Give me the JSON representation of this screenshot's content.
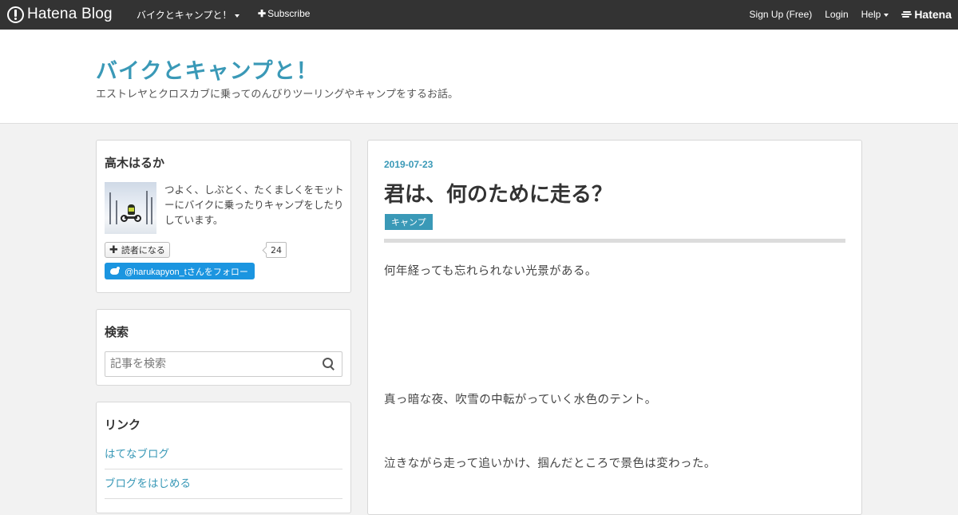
{
  "globalheader": {
    "logo_text": "Hatena Blog",
    "blog_name": "バイクとキャンプと！",
    "subscribe": "Subscribe",
    "signup": "Sign Up (Free)",
    "login": "Login",
    "help": "Help",
    "hatena": "Hatena"
  },
  "blog": {
    "title": "バイクとキャンプと！",
    "description": "エストレヤとクロスカブに乗ってのんびりツーリングやキャンプをするお話。"
  },
  "sidebar": {
    "profile": {
      "title": "高木はるか",
      "text": "つよく、しぶとく、たくましくをモットーにバイクに乗ったりキャンプをしたりしています。",
      "reader_button": "読者になる",
      "reader_count": "24",
      "twitter_follow": "@harukapyon_tさんをフォロー"
    },
    "search": {
      "title": "検索",
      "placeholder": "記事を検索"
    },
    "links": {
      "title": "リンク",
      "items": [
        "はてなブログ",
        "ブログをはじめる"
      ]
    }
  },
  "entry": {
    "date": "2019-07-23",
    "title": "君は、何のために走る？",
    "category": "キャンプ",
    "paragraphs": [
      "何年経っても忘れられない光景がある。",
      "真っ暗な夜、吹雪の中転がっていく水色のテント。",
      "泣きながら走って追いかけ、掴んだところで景色は変わった。"
    ]
  },
  "icons": {
    "logo": "hatena-blog-logo-icon",
    "search": "search-icon",
    "twitter": "twitter-bird-icon"
  },
  "colors": {
    "accent": "#3a99b7",
    "header_bg": "#333333",
    "twitter": "#1b95e0"
  }
}
